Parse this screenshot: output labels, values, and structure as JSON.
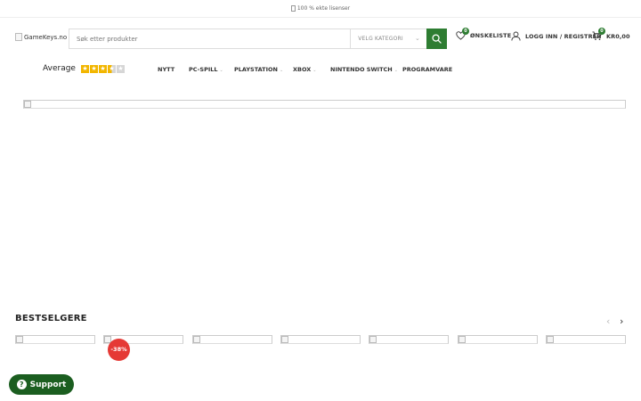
{
  "topbar": {
    "text": "100 % ekte lisenser"
  },
  "header": {
    "logo_alt": "GameKeys.no",
    "search_placeholder": "Søk etter produkter",
    "category_label": "VELG KATEGORI",
    "wishlist": {
      "label": "ØNSKELISTE",
      "count": "0"
    },
    "account": {
      "label": "LOGG INN / REGISTRER"
    },
    "cart": {
      "label": "KR0,00",
      "count": "0"
    }
  },
  "rating": {
    "label": "Average",
    "value": 3.5,
    "max": 5,
    "star_color": "#f2b600",
    "empty_color": "#d6d6d6"
  },
  "nav": {
    "items": [
      {
        "label": "NYTT",
        "dropdown": false
      },
      {
        "label": "PC-SPILL",
        "dropdown": true
      },
      {
        "label": "PLAYSTATION",
        "dropdown": true
      },
      {
        "label": "XBOX",
        "dropdown": true
      },
      {
        "label": "NINTENDO SWITCH",
        "dropdown": true
      },
      {
        "label": "PROGRAMVARE",
        "dropdown": false
      }
    ]
  },
  "bestsellers": {
    "title": "BESTSELGERE",
    "sale_badge": "-38%"
  },
  "support": {
    "label": "Support"
  },
  "colors": {
    "accent": "#2e7d32",
    "support_bg": "#1b5e20",
    "sale": "#e53935"
  }
}
